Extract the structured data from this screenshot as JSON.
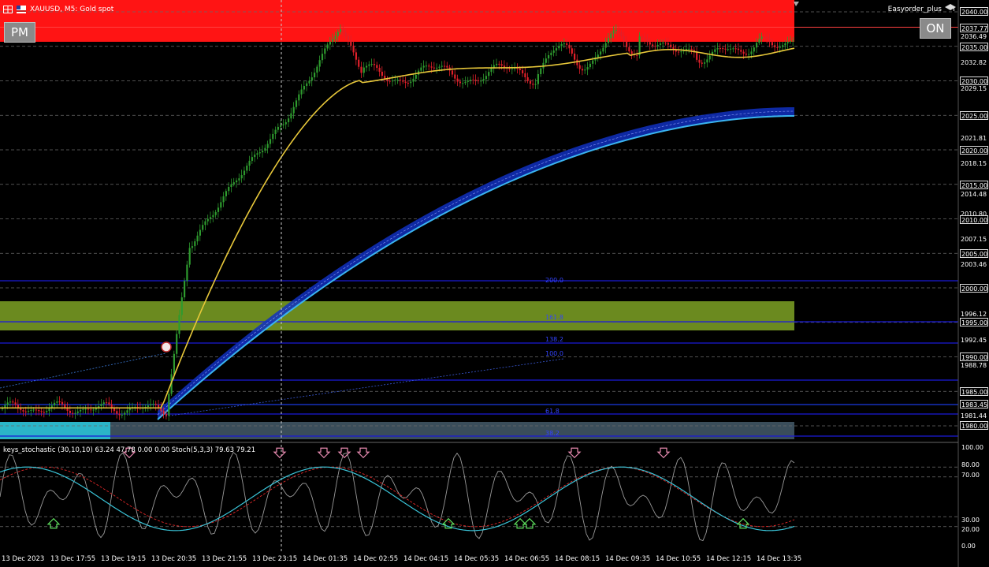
{
  "header": {
    "symbol": "XAUUSD, M5:  Gold spot"
  },
  "buttons": {
    "pm": "PM",
    "on": "ON"
  },
  "ea": {
    "name": "Easyorder_plus"
  },
  "indicator_title": "keys_stochastic (30,10,10) 63.24 47.78 0.00 0.00  Stoch(5,3,3) 79.63 79.21",
  "price_axis": [
    {
      "v": "2040.00",
      "boxed": true
    },
    {
      "v": "2037.77",
      "boxed": true
    },
    {
      "v": "2036.49",
      "boxed": false
    },
    {
      "v": "2035.00",
      "boxed": true
    },
    {
      "v": "2032.82",
      "boxed": false
    },
    {
      "v": "2030.00",
      "boxed": true
    },
    {
      "v": "2029.15",
      "boxed": false
    },
    {
      "v": "2025.00",
      "boxed": true
    },
    {
      "v": "2021.81",
      "boxed": false
    },
    {
      "v": "2020.00",
      "boxed": true
    },
    {
      "v": "2018.15",
      "boxed": false
    },
    {
      "v": "2015.00",
      "boxed": true
    },
    {
      "v": "2014.48",
      "boxed": false
    },
    {
      "v": "2010.80",
      "boxed": false
    },
    {
      "v": "2010.00",
      "boxed": true
    },
    {
      "v": "2007.15",
      "boxed": false
    },
    {
      "v": "2005.00",
      "boxed": true
    },
    {
      "v": "2003.46",
      "boxed": false
    },
    {
      "v": "2000.00",
      "boxed": true
    },
    {
      "v": "1996.12",
      "boxed": false
    },
    {
      "v": "1995.00",
      "boxed": true
    },
    {
      "v": "1992.45",
      "boxed": false
    },
    {
      "v": "1990.00",
      "boxed": true
    },
    {
      "v": "1988.78",
      "boxed": false
    },
    {
      "v": "1985.00",
      "boxed": true
    },
    {
      "v": "1983.45",
      "boxed": true
    },
    {
      "v": "1981.44",
      "boxed": false
    },
    {
      "v": "1980.00",
      "boxed": true
    }
  ],
  "fib_levels": [
    "200.0",
    "161.8",
    "138.2",
    "100.0",
    "61.8",
    "38.2"
  ],
  "stoch_axis": [
    "100.00",
    "80.00",
    "70.00",
    "30.00",
    "20.00",
    "0.00"
  ],
  "time_axis": [
    "13 Dec 2023",
    "13 Dec 17:55",
    "13 Dec 19:15",
    "13 Dec 20:35",
    "13 Dec 21:55",
    "13 Dec 23:15",
    "14 Dec 01:35",
    "14 Dec 02:55",
    "14 Dec 04:15",
    "14 Dec 05:35",
    "14 Dec 06:55",
    "14 Dec 08:15",
    "14 Dec 09:35",
    "14 Dec 10:55",
    "14 Dec 12:15",
    "14 Dec 13:35"
  ],
  "colors": {
    "bull": "#2e9a2e",
    "bear": "#e0202a",
    "ma": "#e8c83a",
    "band": "#1030c0",
    "band_edge": "#3ab4f0",
    "red_zone": "#ff1010",
    "green_zone": "#6b8a1f",
    "fib_line": "#1a1ad8",
    "stoch_main": "#9a9a9a",
    "stoch_signal": "#3ac4d8",
    "stoch_slow": "#e02828"
  }
}
